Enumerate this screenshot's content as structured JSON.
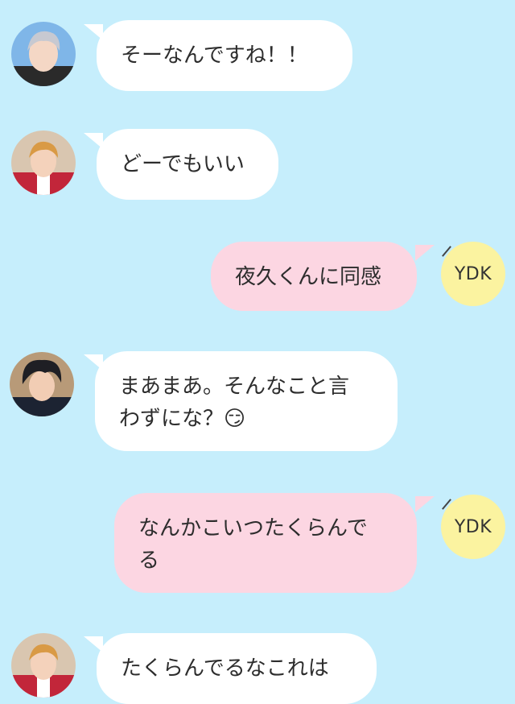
{
  "messages": [
    {
      "side": "left",
      "text": "そーなんですね！！",
      "avatar": "silver-hair-character-avatar"
    },
    {
      "side": "left",
      "text": "どーでもいい",
      "avatar": "blond-hair-character-avatar"
    },
    {
      "side": "right",
      "text": "夜久くんに同感",
      "avatar_label": "YDK"
    },
    {
      "side": "left",
      "text": "まあまあ。そんなこと言\nわずにな？😏",
      "avatar": "black-hair-character-avatar"
    },
    {
      "side": "right",
      "text": "なんかこいつたくらんで\nる",
      "avatar_label": "YDK"
    },
    {
      "side": "left",
      "text": "たくらんでるなこれは",
      "avatar": "blond-hair-character-avatar"
    }
  ],
  "colors": {
    "background": "#c6eefc",
    "incoming_bubble": "#ffffff",
    "outgoing_bubble": "#fcd6e2",
    "ydk_avatar": "#fbf3a0"
  }
}
